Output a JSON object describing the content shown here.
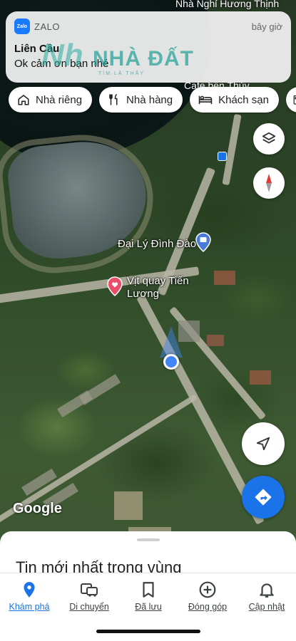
{
  "notification": {
    "app_name": "ZALO",
    "app_icon_text": "Zalo",
    "time": "bây giờ",
    "title": "Liên Cầu",
    "body": "Ok cảm ơn bạn nhé"
  },
  "watermark": {
    "icon_text": "Nh",
    "text": "NHÀ ĐẤT",
    "subtext": "TÌM LÀ THẤY"
  },
  "map": {
    "top_label": "Nhà Nghỉ Hương Thịnh",
    "cafe_label": "Cafe bến Thủy",
    "poi_daily": "Đại Lý Đình Đào",
    "poi_vit_line1": "Vịt quay Tiến",
    "poi_vit_line2": "Lương",
    "google_logo": "Google"
  },
  "chips": [
    {
      "label": "Nhà riêng",
      "icon": "home-icon"
    },
    {
      "label": "Nhà hàng",
      "icon": "restaurant-icon"
    },
    {
      "label": "Khách sạn",
      "icon": "hotel-icon"
    },
    {
      "label": "",
      "icon": "gas-station-icon"
    }
  ],
  "sheet": {
    "title": "Tin mới nhất trong vùng"
  },
  "tabs": [
    {
      "label": "Khám phá",
      "icon": "explore-pin-icon",
      "active": true
    },
    {
      "label": "Di chuyển",
      "icon": "commute-icon",
      "active": false
    },
    {
      "label": "Đã lưu",
      "icon": "bookmark-icon",
      "active": false
    },
    {
      "label": "Đóng góp",
      "icon": "contribute-plus-icon",
      "active": false
    },
    {
      "label": "Cập nhật",
      "icon": "bell-icon",
      "active": false
    }
  ],
  "colors": {
    "accent": "#1a73e8",
    "user_location": "#4285f4",
    "poi_pin": "#ea4c6a"
  }
}
